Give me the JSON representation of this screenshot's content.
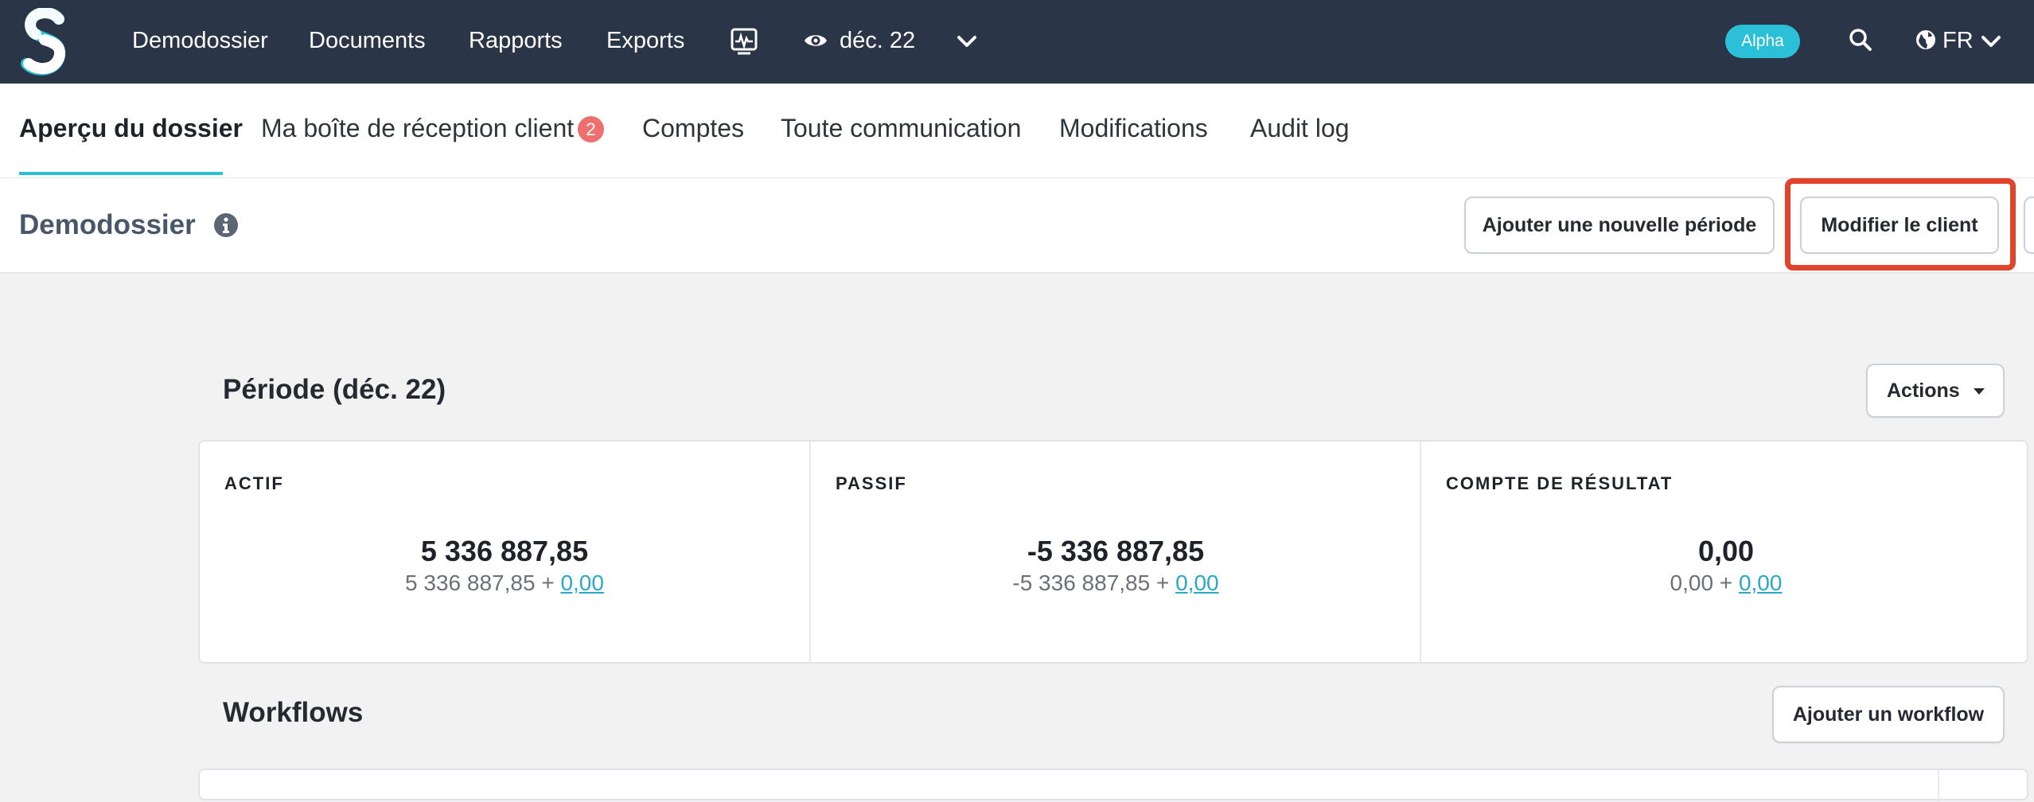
{
  "topnav": {
    "items": [
      "Demodossier",
      "Documents",
      "Rapports",
      "Exports"
    ],
    "period": "déc. 22",
    "badge": "Alpha",
    "language": "FR",
    "icons": [
      "logo-s",
      "monitor-icon",
      "eye-icon",
      "chevron-down-icon",
      "search-icon",
      "globe-icon"
    ]
  },
  "tabs": {
    "items": [
      "Aperçu du dossier",
      "Ma boîte de réception client",
      "Comptes",
      "Toute communication",
      "Modifications",
      "Audit log"
    ],
    "inbox_count": "2",
    "active": "Aperçu du dossier"
  },
  "header": {
    "title": "Demodossier",
    "add_period_label": "Ajouter une nouvelle période",
    "edit_client_label": "Modifier le client"
  },
  "period": {
    "title": "Période (déc. 22)",
    "actions_label": "Actions",
    "cards": [
      {
        "label": "ACTIF",
        "value": "5 336 887,85",
        "base": "5 336 887,85 +",
        "delta": "0,00"
      },
      {
        "label": "PASSIF",
        "value": "-5 336 887,85",
        "base": "-5 336 887,85 +",
        "delta": "0,00"
      },
      {
        "label": "COMPTE DE RÉSULTAT",
        "value": "0,00",
        "base": "0,00 +",
        "delta": "0,00"
      }
    ]
  },
  "workflows": {
    "title": "Workflows",
    "add_label": "Ajouter un workflow"
  },
  "colors": {
    "topbar": "#2a3548",
    "accent": "#2bbfd8",
    "badge": "#ee6f6f",
    "highlight": "#e0442a",
    "link": "#2aa9c7"
  }
}
